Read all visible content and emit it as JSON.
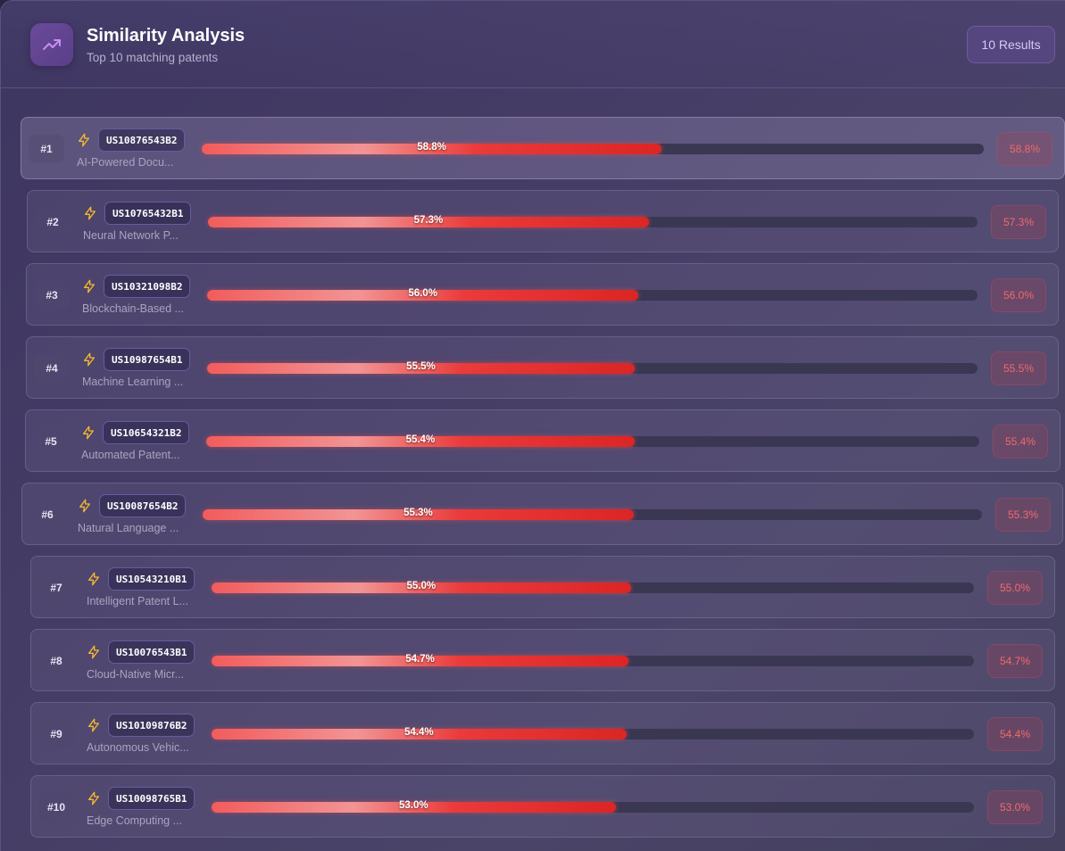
{
  "header": {
    "title": "Similarity Analysis",
    "subtitle": "Top 10 matching patents",
    "results_badge": "10 Results",
    "icon": "trending-up-icon"
  },
  "results": [
    {
      "rank": "#1",
      "patent_id": "US10876543B2",
      "title": "AI-Powered Docu...",
      "score": 58.8,
      "score_label": "58.8%"
    },
    {
      "rank": "#2",
      "patent_id": "US10765432B1",
      "title": "Neural Network P...",
      "score": 57.3,
      "score_label": "57.3%"
    },
    {
      "rank": "#3",
      "patent_id": "US10321098B2",
      "title": "Blockchain-Based ...",
      "score": 56.0,
      "score_label": "56.0%"
    },
    {
      "rank": "#4",
      "patent_id": "US10987654B1",
      "title": "Machine Learning ...",
      "score": 55.5,
      "score_label": "55.5%"
    },
    {
      "rank": "#5",
      "patent_id": "US10654321B2",
      "title": "Automated Patent...",
      "score": 55.4,
      "score_label": "55.4%"
    },
    {
      "rank": "#6",
      "patent_id": "US10087654B2",
      "title": "Natural Language ...",
      "score": 55.3,
      "score_label": "55.3%"
    },
    {
      "rank": "#7",
      "patent_id": "US10543210B1",
      "title": "Intelligent Patent L...",
      "score": 55.0,
      "score_label": "55.0%"
    },
    {
      "rank": "#8",
      "patent_id": "US10076543B1",
      "title": "Cloud-Native Micr...",
      "score": 54.7,
      "score_label": "54.7%"
    },
    {
      "rank": "#9",
      "patent_id": "US10109876B2",
      "title": "Autonomous Vehic...",
      "score": 54.4,
      "score_label": "54.4%"
    },
    {
      "rank": "#10",
      "patent_id": "US10098765B1",
      "title": "Edge Computing ...",
      "score": 53.0,
      "score_label": "53.0%"
    }
  ],
  "row_icon": "lightning-bolt-icon",
  "colors": {
    "bar_start": "#f25c5c",
    "bar_end": "#dc2525",
    "score_text": "#f06a6a",
    "accent": "#a06ae0",
    "bolt": "#f5b82e"
  }
}
